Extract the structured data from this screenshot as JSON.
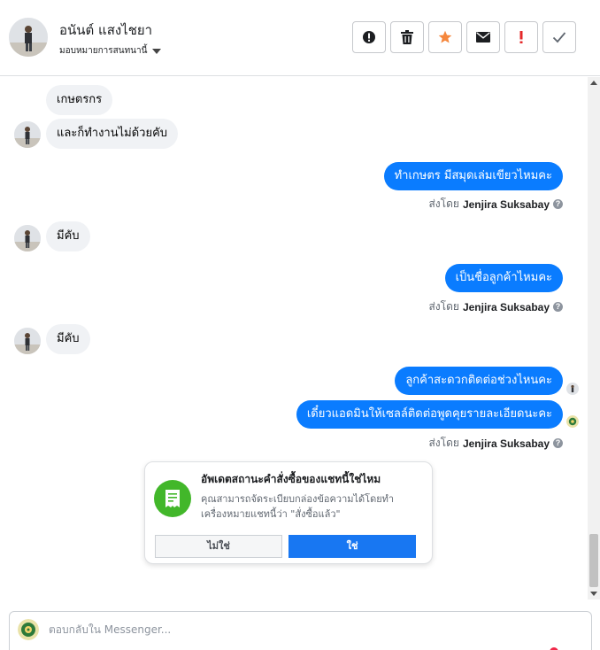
{
  "contact": {
    "name": "อนันต์ แสงไชยา",
    "assign_label": "มอบหมายการสนทนานี้"
  },
  "toolbar": {
    "buttons": [
      {
        "name": "spam-report",
        "icon": "exclamation-circle-icon"
      },
      {
        "name": "delete",
        "icon": "trash-icon"
      },
      {
        "name": "star",
        "icon": "star-icon",
        "color": "#f5873d"
      },
      {
        "name": "mark-unread",
        "icon": "envelope-icon"
      },
      {
        "name": "follow-up",
        "icon": "exclamation-mark-icon",
        "color": "#e4292a"
      },
      {
        "name": "mark-done",
        "icon": "checkmark-icon"
      }
    ]
  },
  "messages": [
    {
      "dir": "in",
      "text": "เกษตรกร"
    },
    {
      "dir": "in",
      "text": "และก็ทำงานไม่ด้วยคับ"
    },
    {
      "dir": "out",
      "text": "ทำเกษตร มีสมุดเล่มเขียวไหมคะ"
    },
    {
      "dir": "in",
      "text": "มีคับ"
    },
    {
      "dir": "out",
      "text": "เป็นชื่อลูกค้าไหมคะ"
    },
    {
      "dir": "in",
      "text": "มีคับ"
    },
    {
      "dir": "out",
      "text": "ลูกค้าสะดวกติดต่อช่วงไหนคะ"
    },
    {
      "dir": "out",
      "text": "เดี๋ยวแอดมินให้เซลล์ติดต่อพูดคุยรายละเอียดนะคะ"
    }
  ],
  "sent_by": {
    "prefix": "ส่งโดย",
    "name": "Jenjira Suksabay",
    "help": "?"
  },
  "prompt": {
    "title": "อัพเดตสถานะคำสั่งซื้อของแชทนี้ใช่ไหม",
    "body": "คุณสามารถจัดระเบียบกล่องข้อความได้โดยทำเครื่องหมายแชทนี้ว่า \"สั่งซื้อแล้ว\"",
    "no_label": "ไม่ใช่",
    "yes_label": "ใช่"
  },
  "reply": {
    "placeholder": "ตอบกลับใน Messenger..."
  },
  "colors": {
    "outgoing_bubble": "#0a7cff",
    "incoming_bubble": "#f0f2f5",
    "primary_button": "#1877f2",
    "prompt_icon_bg": "#42b72a"
  }
}
